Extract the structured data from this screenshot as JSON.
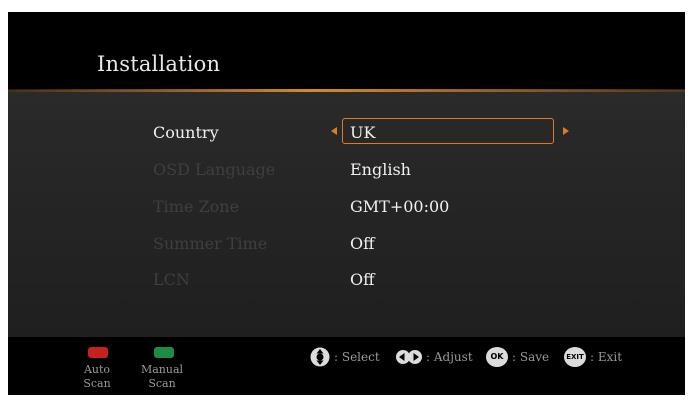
{
  "header": {
    "title": "Installation"
  },
  "settings": [
    {
      "label": "Country",
      "value": "UK",
      "selected": true
    },
    {
      "label": "OSD Language",
      "value": "English",
      "selected": false
    },
    {
      "label": "Time Zone",
      "value": "GMT+00:00",
      "selected": false
    },
    {
      "label": "Summer Time",
      "value": "Off",
      "selected": false
    },
    {
      "label": "LCN",
      "value": "Off",
      "selected": false
    }
  ],
  "footer": {
    "red_key": {
      "line1": "Auto",
      "line2": "Scan",
      "color": "#c8201c"
    },
    "green_key": {
      "line1": "Manual",
      "line2": "Scan",
      "color": "#1d8c45"
    },
    "hints": {
      "select": ": Select",
      "adjust": ": Adjust",
      "ok_badge": "OK",
      "save": ": Save",
      "exit_badge": "EXIT",
      "exit": ": Exit"
    }
  },
  "colors": {
    "accent": "#e07c1e",
    "selected_text": "#f0f0f0",
    "dim_text": "#3f3f3f"
  }
}
